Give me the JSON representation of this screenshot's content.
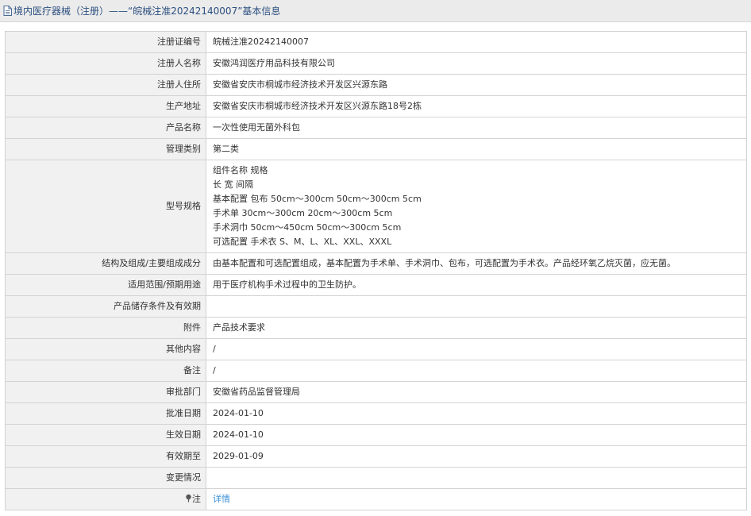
{
  "header": {
    "title": "境内医疗器械（注册）——“皖械注准20242140007”基本信息",
    "icon": "document-icon"
  },
  "rows": [
    {
      "label": "注册证编号",
      "value": "皖械注准20242140007"
    },
    {
      "label": "注册人名称",
      "value": "安徽鸿润医疗用品科技有限公司"
    },
    {
      "label": "注册人住所",
      "value": "安徽省安庆市桐城市经济技术开发区兴源东路"
    },
    {
      "label": "生产地址",
      "value": "安徽省安庆市桐城市经济技术开发区兴源东路18号2栋"
    },
    {
      "label": "产品名称",
      "value": "一次性使用无菌外科包"
    },
    {
      "label": "管理类别",
      "value": "第二类"
    },
    {
      "label": "型号规格",
      "lines": [
        "组件名称 规格",
        "长 宽 间隔",
        "基本配置 包布 50cm～300cm 50cm～300cm 5cm",
        "手术单 30cm～300cm 20cm～300cm 5cm",
        "手术洞巾 50cm～450cm 50cm～300cm 5cm",
        "可选配置 手术衣 S、M、L、XL、XXL、XXXL"
      ]
    },
    {
      "label": "结构及组成/主要组成成分",
      "value": "由基本配置和可选配置组成，基本配置为手术单、手术洞巾、包布，可选配置为手术衣。产品经环氧乙烷灭菌，应无菌。"
    },
    {
      "label": "适用范围/预期用途",
      "value": "用于医疗机构手术过程中的卫生防护。"
    },
    {
      "label": "产品储存条件及有效期",
      "value": ""
    },
    {
      "label": "附件",
      "value": "产品技术要求"
    },
    {
      "label": "其他内容",
      "value": "/"
    },
    {
      "label": "备注",
      "value": "/"
    },
    {
      "label": "审批部门",
      "value": "安徽省药品监督管理局"
    },
    {
      "label": "批准日期",
      "value": "2024-01-10"
    },
    {
      "label": "生效日期",
      "value": "2024-01-10"
    },
    {
      "label": "有效期至",
      "value": "2029-01-09"
    },
    {
      "label": "变更情况",
      "value": ""
    }
  ],
  "note_row": {
    "label": "注",
    "icon": "pin-icon",
    "link": "详情"
  },
  "colors": {
    "header_bg": "#ebebeb",
    "header_text": "#2b4f7f",
    "label_bg": "#f1f1f1",
    "border": "#d3d3d3",
    "link": "#3a8fd6"
  }
}
